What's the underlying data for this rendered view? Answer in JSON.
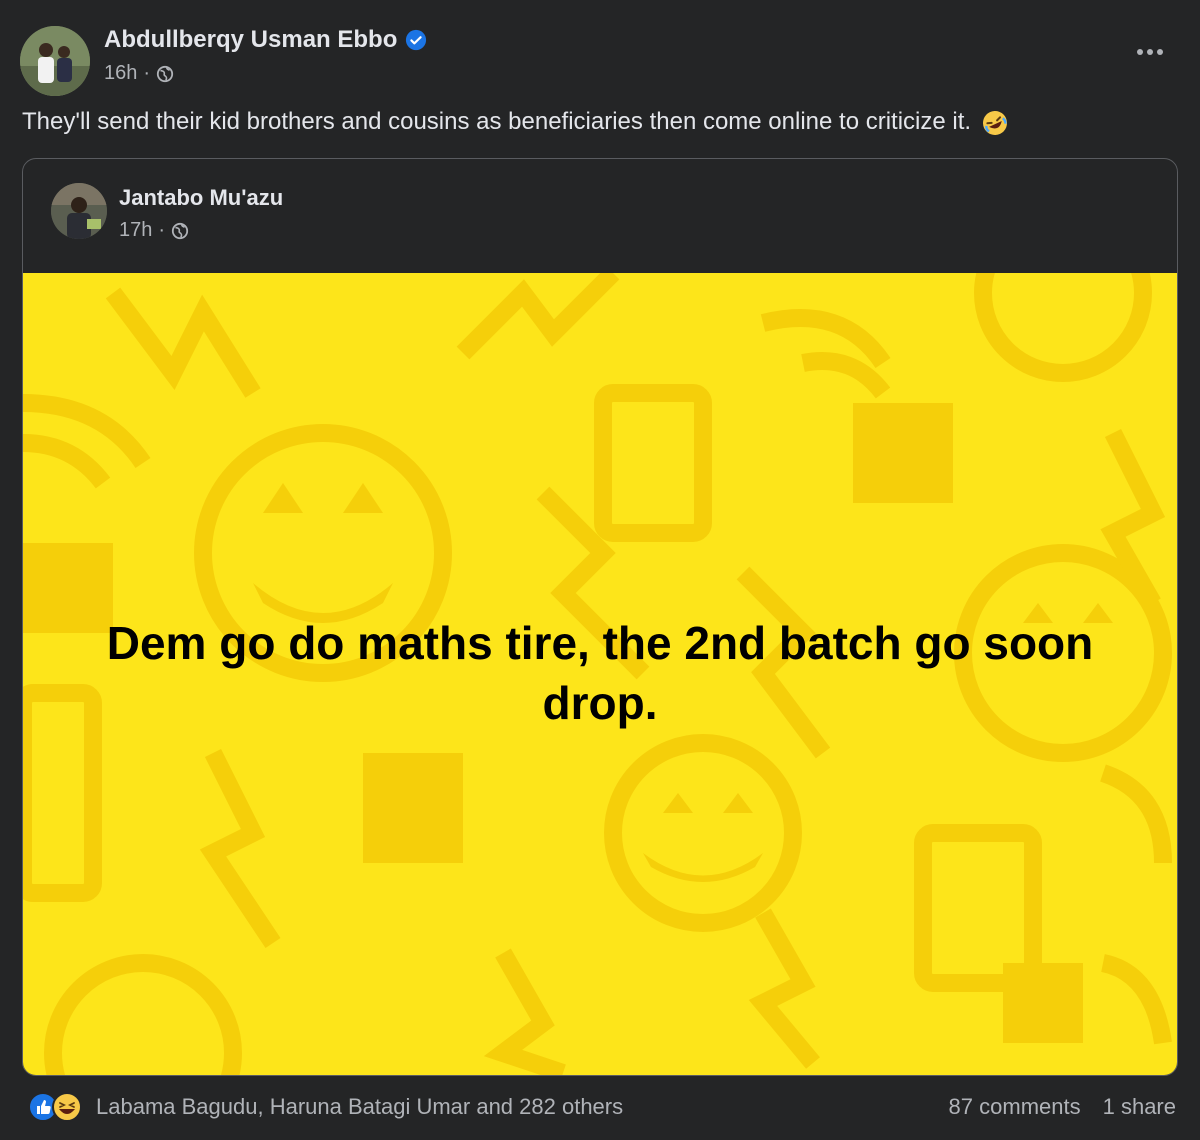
{
  "post": {
    "author": "Abdullberqy Usman Ebbo",
    "time": "16h",
    "separator": "·",
    "text": "They'll send their kid brothers and cousins as beneficiaries then come online to criticize it."
  },
  "shared_post": {
    "author": "Jantabo Mu'azu",
    "time": "17h",
    "separator": "·",
    "quote": "Dem go do maths tire, the 2nd batch go soon drop.",
    "background_color": "#fde51a"
  },
  "footer": {
    "reaction_names": "Labama Bagudu, Haruna Batagi Umar and 282 others",
    "comments": "87 comments",
    "shares": "1 share"
  },
  "icons": {
    "verified": "verified-badge-icon",
    "globe": "globe-icon",
    "more": "more-options-icon",
    "like": "like-reaction-icon",
    "haha": "haha-reaction-icon",
    "rofl": "rolling-laughing-emoji"
  },
  "colors": {
    "background": "#242526",
    "accent_blue": "#1b74e4"
  }
}
